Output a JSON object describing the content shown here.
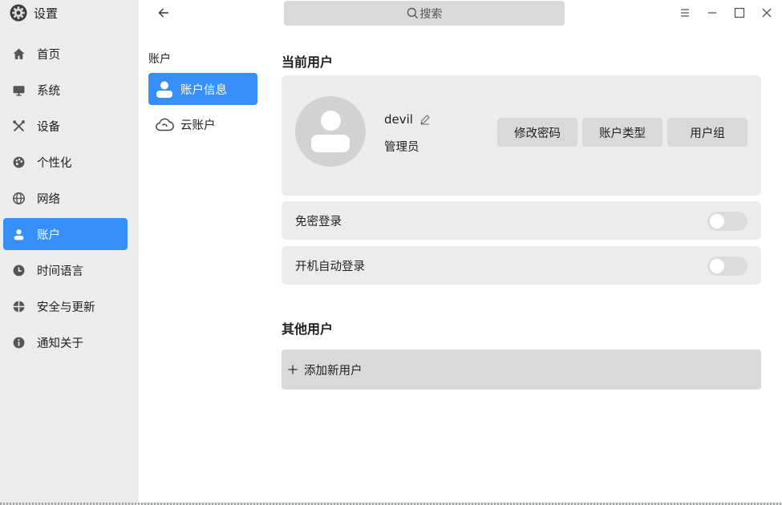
{
  "app": {
    "title": "设置",
    "logo_icon": "gear-icon"
  },
  "sidebar": {
    "items": [
      {
        "label": "首页",
        "icon": "home-icon",
        "active": false
      },
      {
        "label": "系统",
        "icon": "monitor-icon",
        "active": false
      },
      {
        "label": "设备",
        "icon": "tools-icon",
        "active": false
      },
      {
        "label": "个性化",
        "icon": "palette-icon",
        "active": false
      },
      {
        "label": "网络",
        "icon": "globe-icon",
        "active": false
      },
      {
        "label": "账户",
        "icon": "user-icon",
        "active": true
      },
      {
        "label": "时间语言",
        "icon": "clock-icon",
        "active": false
      },
      {
        "label": "安全与更新",
        "icon": "shield-icon",
        "active": false
      },
      {
        "label": "通知关于",
        "icon": "info-icon",
        "active": false
      }
    ]
  },
  "subnav": {
    "title": "账户",
    "items": [
      {
        "label": "账户信息",
        "icon": "user-icon",
        "active": true
      },
      {
        "label": "云账户",
        "icon": "cloud-icon",
        "active": false
      }
    ]
  },
  "search": {
    "placeholder": "搜索"
  },
  "current_user": {
    "section_title": "当前用户",
    "name": "devil",
    "type": "管理员",
    "buttons": {
      "change_password": "修改密码",
      "account_type": "账户类型",
      "user_group": "用户组"
    }
  },
  "settings": {
    "passwordless_login": {
      "label": "免密登录",
      "enabled": false
    },
    "auto_login": {
      "label": "开机自动登录",
      "enabled": false
    }
  },
  "other_users": {
    "section_title": "其他用户",
    "add_label": "添加新用户"
  },
  "colors": {
    "accent": "#3790fa",
    "sidebar_bg": "#ececec",
    "card_bg": "#ececec",
    "button_bg": "#d9d9d9"
  }
}
